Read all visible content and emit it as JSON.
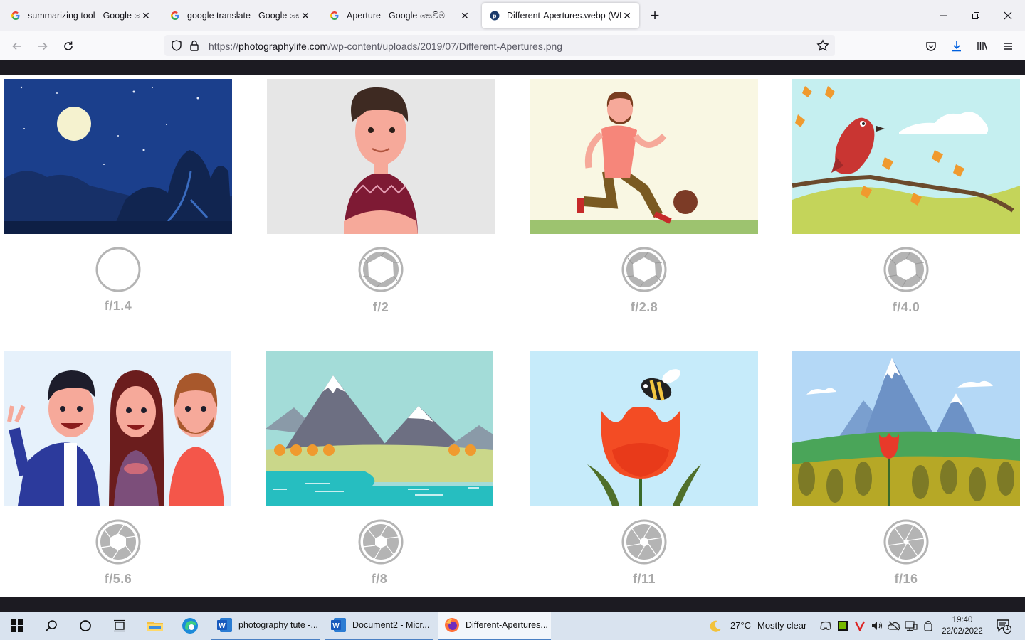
{
  "browser": {
    "tabs": [
      {
        "label": "summarizing tool - Google සෙ",
        "active": false,
        "icon": "google-g-icon"
      },
      {
        "label": "google translate - Google සෙවි",
        "active": false,
        "icon": "google-g-icon"
      },
      {
        "label": "Aperture - Google සෙවීම",
        "active": false,
        "icon": "google-g-icon"
      },
      {
        "label": "Different-Apertures.webp (WEBP",
        "active": true,
        "icon": "photographylife-icon"
      }
    ],
    "new_tab_label": "+",
    "url": {
      "prefix": "https://",
      "host": "photographylife.com",
      "path": "/wp-content/uploads/2019/07/Different-Apertures.png"
    }
  },
  "apertures": [
    {
      "label": "f/1.4",
      "scene": "night-sky-moon",
      "blades_closed": 0
    },
    {
      "label": "f/2",
      "scene": "portrait-man",
      "blades_closed": 0.2
    },
    {
      "label": "f/2.8",
      "scene": "football-player",
      "blades_closed": 0.3
    },
    {
      "label": "f/4.0",
      "scene": "bird-on-branch",
      "blades_closed": 0.4
    },
    {
      "label": "f/5.6",
      "scene": "three-people-group",
      "blades_closed": 0.55
    },
    {
      "label": "f/8",
      "scene": "mountain-lake",
      "blades_closed": 0.65
    },
    {
      "label": "f/11",
      "scene": "tulip-and-bee",
      "blades_closed": 0.75
    },
    {
      "label": "f/16",
      "scene": "mountain-meadow",
      "blades_closed": 0.85
    }
  ],
  "taskbar": {
    "apps": [
      {
        "label": "photography tute -...",
        "icon": "word-icon",
        "active": false
      },
      {
        "label": "Document2 - Micr...",
        "icon": "word-icon",
        "active": false
      },
      {
        "label": "Different-Apertures...",
        "icon": "firefox-icon",
        "active": true
      }
    ],
    "weather": {
      "temp": "27°C",
      "condition": "Mostly clear"
    },
    "time": "19:40",
    "date": "22/02/2022",
    "notification_count": "1"
  },
  "colors": {
    "accent": "#0060df",
    "label_grey": "#a9a9a9",
    "taskbar_bg": "#d9e3ef"
  }
}
